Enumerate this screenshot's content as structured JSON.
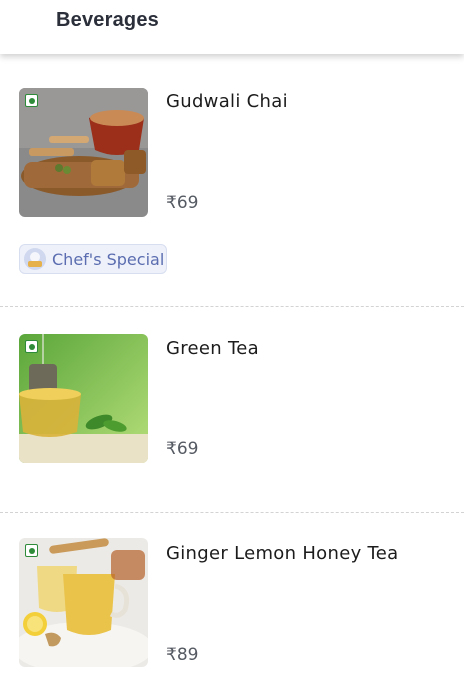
{
  "header": {
    "title": "Beverages"
  },
  "items": [
    {
      "name": "Gudwali Chai",
      "price": "₹69",
      "image_icon": "chai-photo-icon",
      "veg": true,
      "badge": "Chef's Special"
    },
    {
      "name": "Green Tea",
      "price": "₹69",
      "image_icon": "green-tea-photo-icon",
      "veg": true
    },
    {
      "name": "Ginger Lemon Honey Tea",
      "price": "₹89",
      "image_icon": "ginger-lemon-tea-photo-icon",
      "veg": true
    }
  ],
  "colors": {
    "veg": "#2e8b3a",
    "badge_text": "#5b6db0",
    "badge_bg": "#eef1fa"
  }
}
